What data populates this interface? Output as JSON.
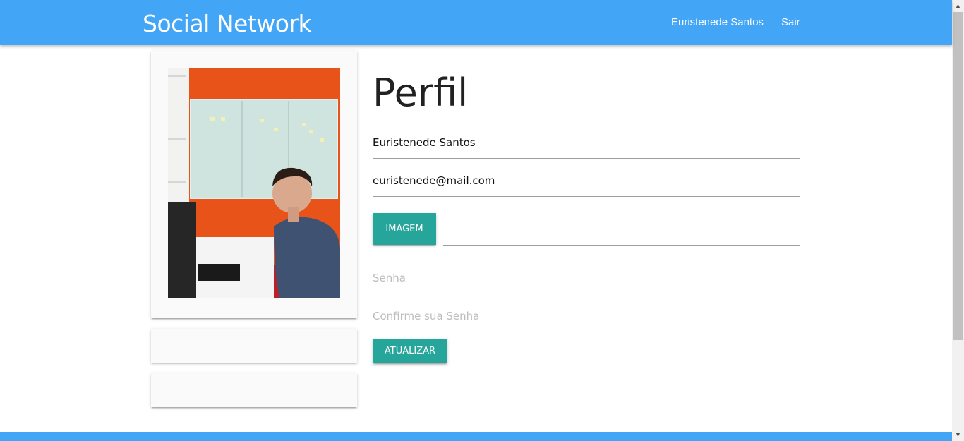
{
  "navbar": {
    "brand": "Social Network",
    "user_name": "Euristenede Santos",
    "logout_label": "Sair",
    "color": "#42a5f5"
  },
  "profile": {
    "title": "Perfil",
    "name_value": "Euristenede Santos",
    "email_value": "euristenede@mail.com",
    "image_button_label": "IMAGEM",
    "password_placeholder": "Senha",
    "confirm_password_placeholder": "Confirme sua Senha",
    "update_button_label": "ATUALIZAR",
    "accent_color": "#26a69a"
  },
  "icons": {
    "scroll_up": "scroll-up-arrow-icon",
    "scroll_down": "scroll-down-arrow-icon"
  }
}
